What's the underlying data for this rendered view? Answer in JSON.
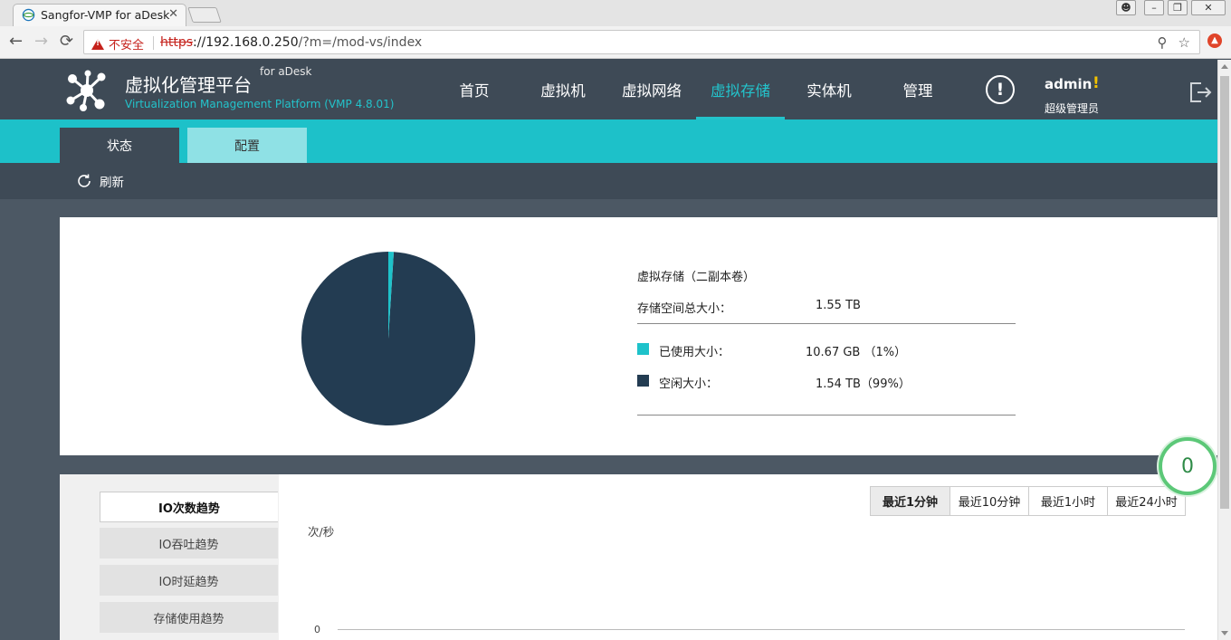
{
  "browser": {
    "tab_title": "Sangfor-VMP for aDesk",
    "security_label": "不安全",
    "url_scheme": "https",
    "url_host": "://192.168.0.250",
    "url_path": "/?m=/mod-vs/index"
  },
  "header": {
    "brand_title": "虚拟化管理平台",
    "brand_sub": "for aDesk",
    "brand_en": "Virtualization Management Platform (VMP 4.8.01)",
    "nav": [
      {
        "label": "首页"
      },
      {
        "label": "虚拟机"
      },
      {
        "label": "虚拟网络"
      },
      {
        "label": "虚拟存储",
        "active": true
      },
      {
        "label": "实体机"
      },
      {
        "label": "管理"
      }
    ],
    "alert_glyph": "!",
    "user": {
      "name": "admin",
      "mark": "!",
      "role": "超级管理员"
    }
  },
  "subtabs": [
    {
      "label": "状态"
    },
    {
      "label": "配置"
    }
  ],
  "toolbar": {
    "refresh_label": "刷新"
  },
  "storage": {
    "heading": "虚拟存储（二副本卷）",
    "total_label": "存储空间总大小：",
    "total_value": "1.55 TB",
    "used_label": "已使用大小：",
    "used_value": "10.67 GB （1%）",
    "free_label": "空闲大小：",
    "free_value": "1.54 TB（99%）",
    "used_fraction": 0.01,
    "colors": {
      "used": "#1ec2ca",
      "free": "#233c52"
    }
  },
  "io": {
    "tabs": [
      {
        "label": "IO次数趋势",
        "active": true
      },
      {
        "label": "IO吞吐趋势"
      },
      {
        "label": "IO时延趋势"
      },
      {
        "label": "存储使用趋势"
      }
    ],
    "ranges": [
      "最近1分钟",
      "最近10分钟",
      "最近1小时",
      "最近24小时"
    ],
    "y_unit": "次/秒",
    "y_zero": "0"
  },
  "float_badge": "0"
}
